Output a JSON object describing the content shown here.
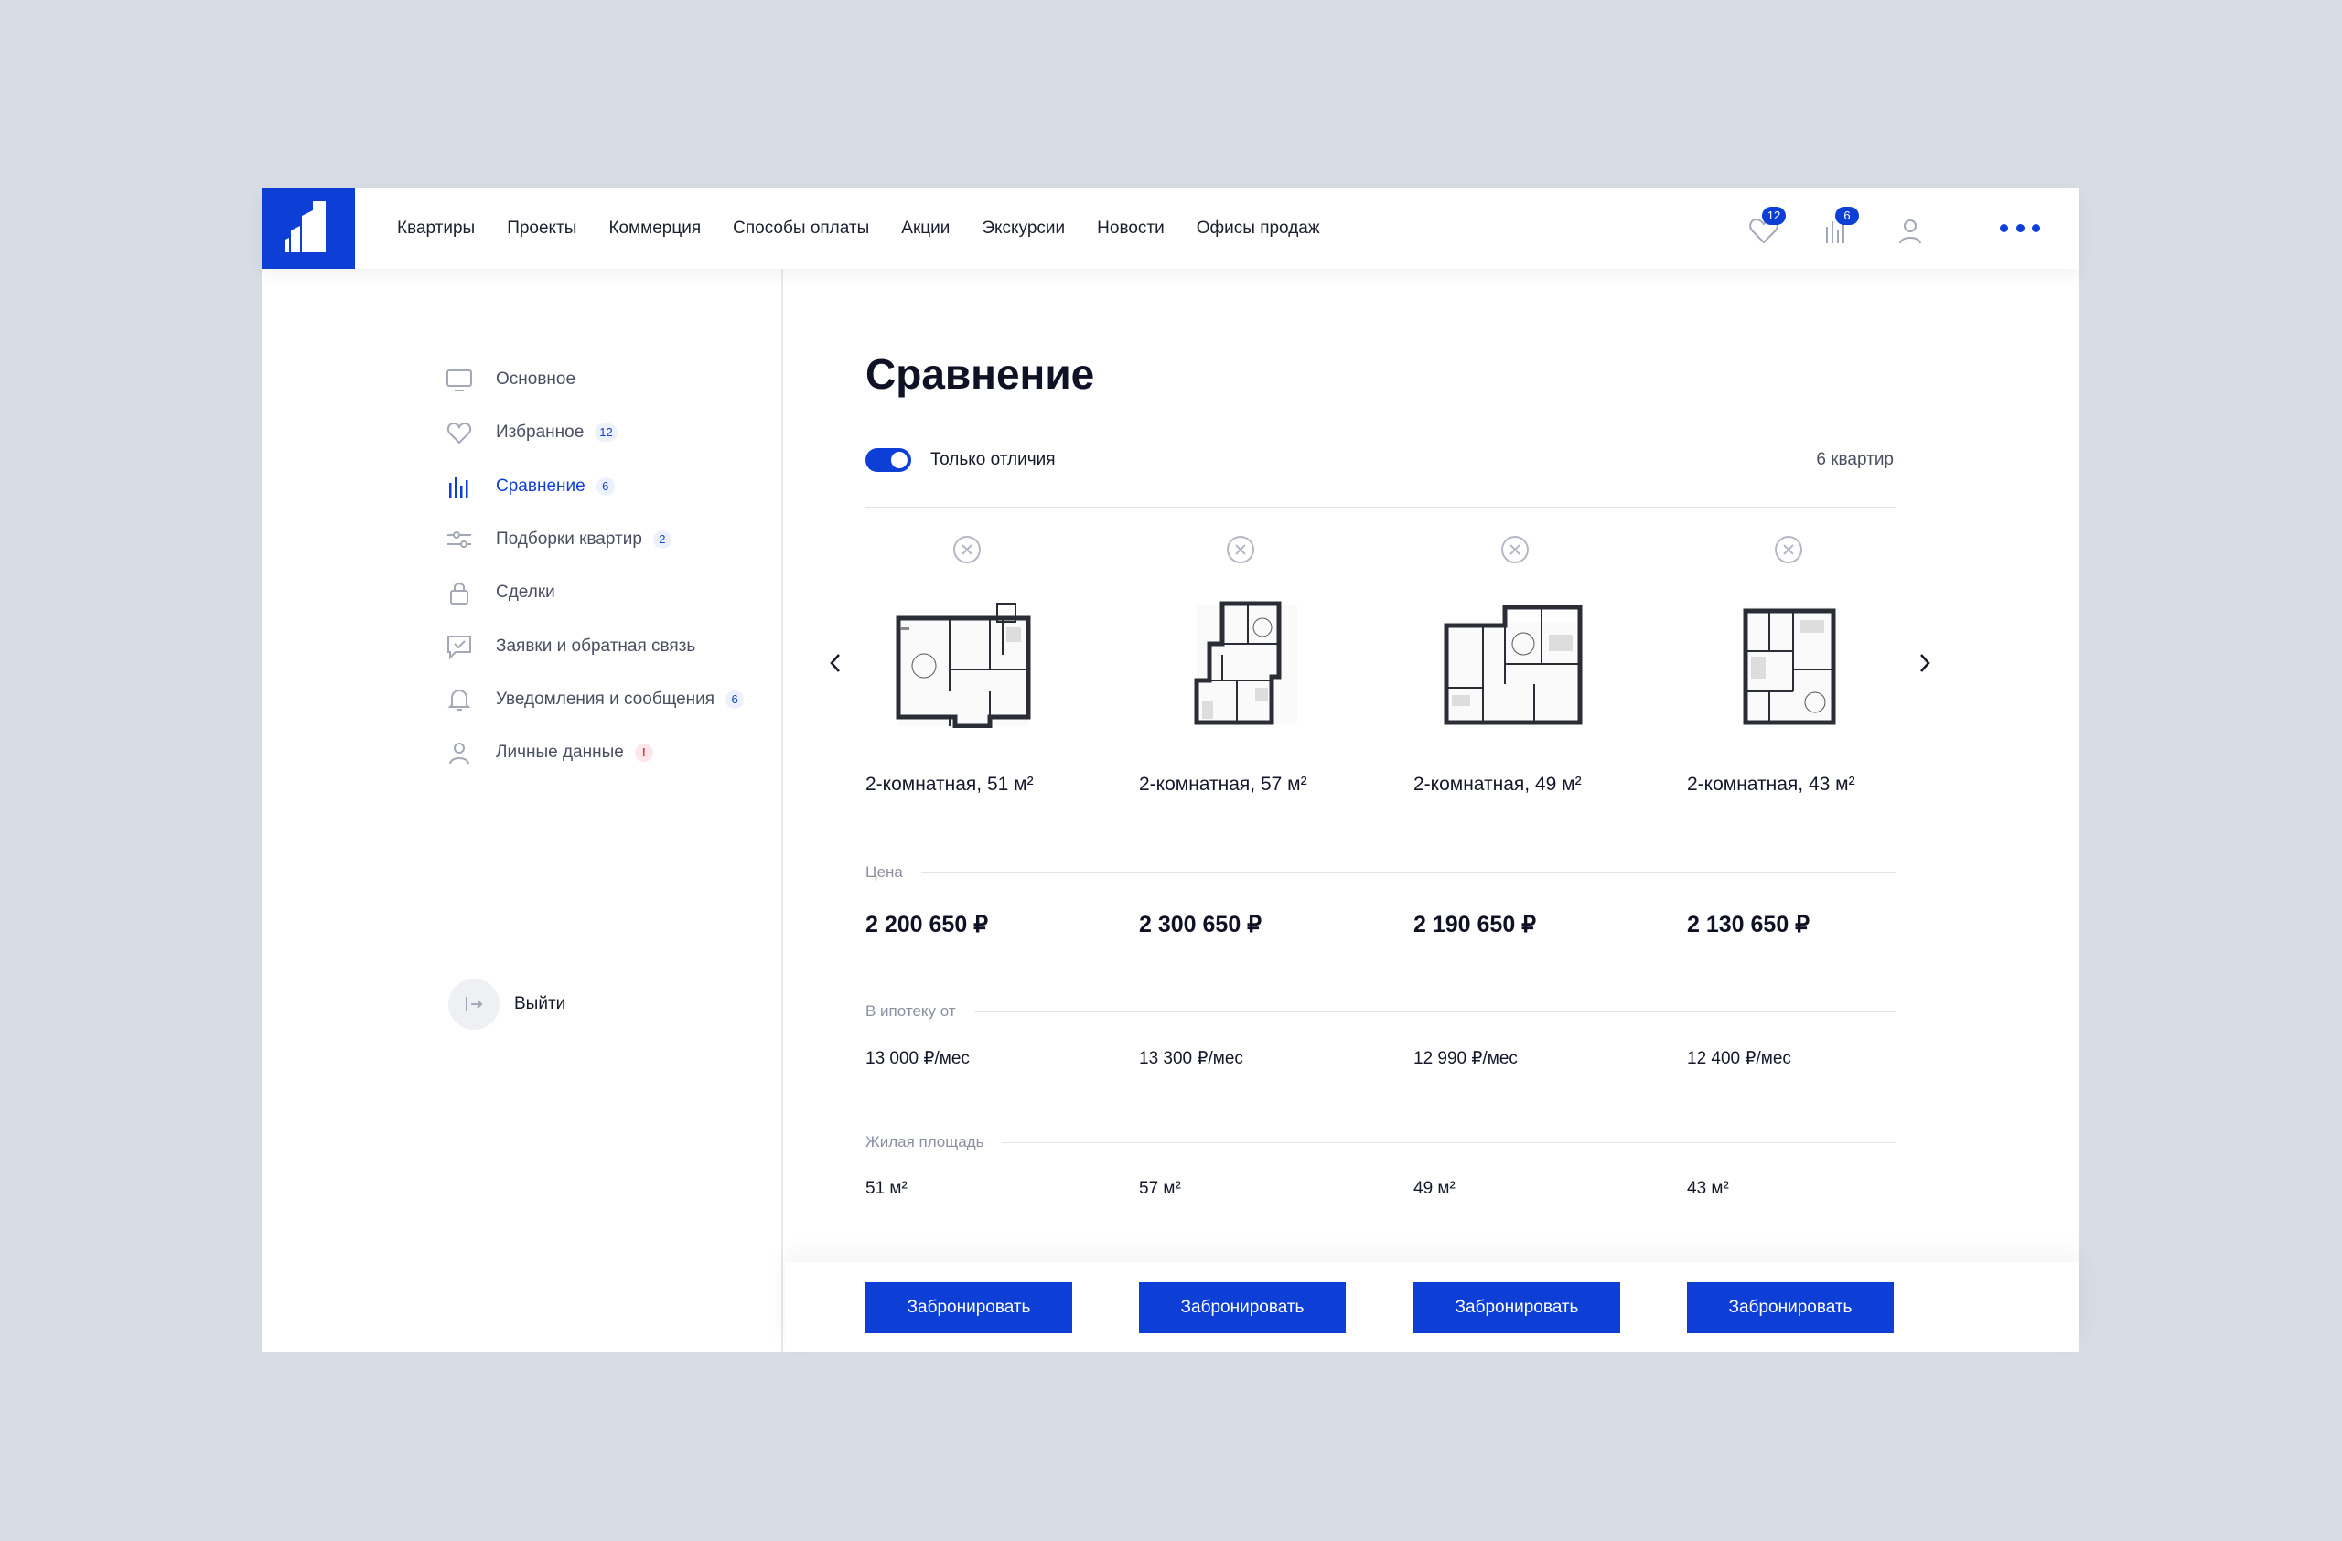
{
  "header": {
    "nav": [
      "Квартиры",
      "Проекты",
      "Коммерция",
      "Способы оплаты",
      "Акции",
      "Экскурсии",
      "Новости",
      "Офисы продаж"
    ],
    "favorites_count": "12",
    "compare_count": "6",
    "icons": [
      "logo",
      "heart-icon",
      "bar-chart-icon",
      "user-icon",
      "more-dots-icon"
    ],
    "accent_color": "#0d3fd6"
  },
  "sidebar": {
    "items": [
      {
        "label": "Основное",
        "icon": "monitor-icon",
        "badge": ""
      },
      {
        "label": "Избранное",
        "icon": "heart-icon",
        "badge": "12"
      },
      {
        "label": "Сравнение",
        "icon": "bar-chart-icon",
        "badge": "6",
        "active": true
      },
      {
        "label": "Подборки квартир",
        "icon": "sliders-icon",
        "badge": "2"
      },
      {
        "label": "Сделки",
        "icon": "lock-icon",
        "badge": ""
      },
      {
        "label": "Заявки и обратная связь",
        "icon": "message-check-icon",
        "badge": ""
      },
      {
        "label": "Уведомления и сообщения",
        "icon": "bell-icon",
        "badge": "6"
      },
      {
        "label": "Личные данные",
        "icon": "user-icon",
        "badge": "!"
      }
    ],
    "logout_label": "Выйти"
  },
  "main": {
    "title": "Сравнение",
    "toggle_label": "Только отличия",
    "toggle_on": true,
    "count_text": "6 квартир",
    "sections": {
      "price": "Цена",
      "mortgage": "В ипотеку от",
      "area": "Жилая площадь"
    },
    "apartments": [
      {
        "title": "2-комнатная, 51 м²",
        "price": "2 200 650 ₽",
        "mortgage": "13 000 ₽/мес",
        "area": "51 м²"
      },
      {
        "title": "2-комнатная, 57 м²",
        "price": "2 300 650 ₽",
        "mortgage": "13 300 ₽/мес",
        "area": "57 м²"
      },
      {
        "title": "2-комнатная, 49 м²",
        "price": "2 190 650 ₽",
        "mortgage": "12 990 ₽/мес",
        "area": "49 м²"
      },
      {
        "title": "2-комнатная, 43 м²",
        "price": "2 130 650 ₽",
        "mortgage": "12 400 ₽/мес",
        "area": "43 м²"
      }
    ],
    "book_label": "Забронировать"
  }
}
